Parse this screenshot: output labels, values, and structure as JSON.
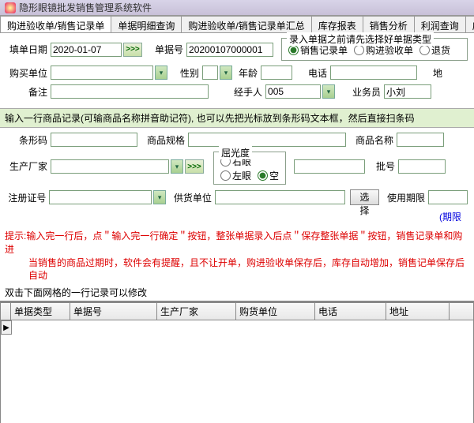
{
  "window": {
    "title": "隐形眼镜批发销售管理系统软件"
  },
  "tabs": {
    "items": [
      "购进验收单/销售记录单",
      "单据明细查询",
      "购进验收单/销售记录单汇总",
      "库存报表",
      "销售分析",
      "利润查询",
      "应收"
    ],
    "active": 0
  },
  "form": {
    "fill_date_label": "填单日期",
    "fill_date": "2020-01-07",
    "doc_no_label": "单据号",
    "doc_no": "20200107000001",
    "type_group_title": "录入单据之前请先选择好单据类型",
    "type_options": [
      "销售记录单",
      "购进验收单",
      "退货"
    ],
    "type_selected": 0,
    "buyer_label": "购买单位",
    "gender_label": "性别",
    "age_label": "年龄",
    "phone_label": "电话",
    "address_label": "地",
    "remark_label": "备注",
    "handler_label": "经手人",
    "handler": "005",
    "salesman_label": "业务员",
    "salesman": "小刘"
  },
  "section1": {
    "text": "输入一行商品记录(可输商品名称拼音助记符), 也可以先把光标放到条形码文本框，然后直接扫条码"
  },
  "product": {
    "barcode_label": "条形码",
    "spec_label": "商品规格",
    "name_label": "商品名称",
    "mfr_label": "生产厂家",
    "diopter_label": "屈光度",
    "diopter_options": [
      "右眼",
      "左眼",
      "空"
    ],
    "diopter_selected": 2,
    "batch_label": "批号",
    "reg_label": "注册证号",
    "supplier_label": "供货单位",
    "select_btn": "选择",
    "expiry_label": "使用期限",
    "period_limit": "(期限"
  },
  "hints": {
    "line1": "提示:输入完一行后，点＂输入完一行确定＂按钮，整张单据录入后点＂保存整张单据＂按钮，销售记录单和购进",
    "line2": "当销售的商品过期时，软件会有提醒，且不让开单，购进验收单保存后，库存自动增加，销售记单保存后自动"
  },
  "grid": {
    "hint": "双击下面网格的一行记录可以修改",
    "columns": [
      "单据类型",
      "单据号",
      "生产厂家",
      "购货单位",
      "电话",
      "地址",
      ""
    ]
  }
}
